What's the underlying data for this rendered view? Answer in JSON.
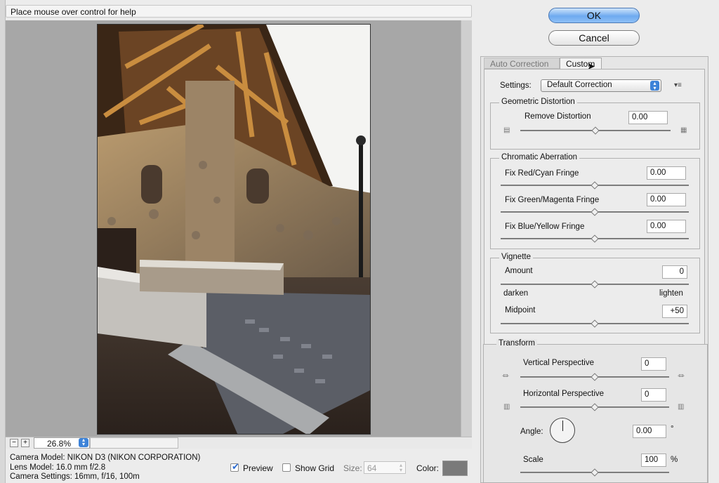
{
  "help_bar": {
    "text": "Place mouse over control for help"
  },
  "buttons": {
    "ok": "OK",
    "cancel": "Cancel"
  },
  "tabs": {
    "auto": "Auto Correction",
    "custom": "Custom"
  },
  "settings": {
    "label": "Settings:",
    "value": "Default Correction"
  },
  "geometric": {
    "title": "Geometric Distortion",
    "remove_label": "Remove Distortion",
    "remove_value": "0.00",
    "remove_level": 0.5
  },
  "chromatic": {
    "title": "Chromatic Aberration",
    "red_label": "Fix Red/Cyan Fringe",
    "red_value": "0.00",
    "green_label": "Fix Green/Magenta Fringe",
    "green_value": "0.00",
    "blue_label": "Fix Blue/Yellow Fringe",
    "blue_value": "0.00"
  },
  "vignette": {
    "title": "Vignette",
    "amount_label": "Amount",
    "amount_value": "0",
    "darken_label": "darken",
    "lighten_label": "lighten",
    "midpoint_label": "Midpoint",
    "midpoint_value": "+50"
  },
  "transform": {
    "title": "Transform",
    "vertical_label": "Vertical Perspective",
    "vertical_value": "0",
    "horizontal_label": "Horizontal Perspective",
    "horizontal_value": "0",
    "angle_label": "Angle:",
    "angle_value": "0.00",
    "angle_unit": "°",
    "scale_label": "Scale",
    "scale_value": "100",
    "scale_unit": "%"
  },
  "zoom": {
    "value": "26.8%"
  },
  "camera": {
    "model": "Camera Model: NIKON D3 (NIKON CORPORATION)",
    "lens": "Lens Model: 16.0 mm f/2.8",
    "settings": "Camera Settings: 16mm, f/16, 100m"
  },
  "bottom": {
    "preview_label": "Preview",
    "preview_checked": true,
    "grid_label": "Show Grid",
    "grid_checked": false,
    "size_label": "Size:",
    "size_value": "64",
    "color_label": "Color:",
    "grid_color": "#7a7a7a"
  },
  "colors": {
    "accent": "#3d83d8",
    "panel": "#e6e6e6",
    "preview_bg": "#a7a7a7"
  }
}
